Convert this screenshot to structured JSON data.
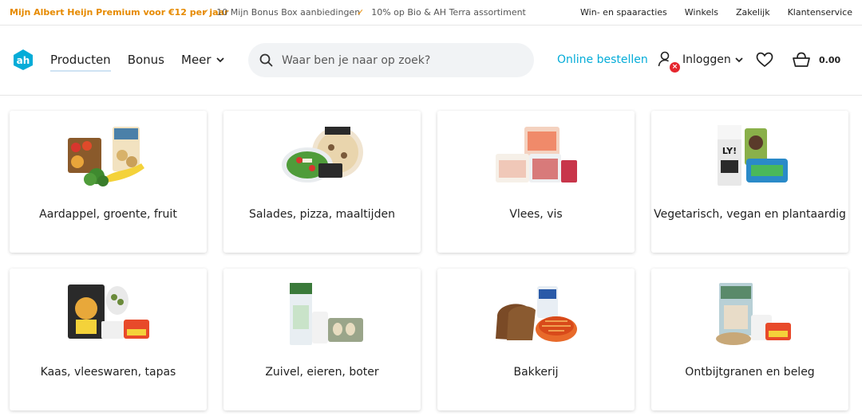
{
  "topbar": {
    "promo": "Mijn Albert Heijn Premium voor €12 per jaar",
    "usps": [
      "10 Mijn Bonus Box aanbiedingen",
      "10% op Bio & AH Terra assortiment"
    ],
    "links": [
      "Win- en spaaracties",
      "Winkels",
      "Zakelijk",
      "Klantenservice"
    ]
  },
  "header": {
    "nav": [
      "Producten",
      "Bonus",
      "Meer"
    ],
    "search_placeholder": "Waar ben je naar op zoek?",
    "online_order": "Online bestellen",
    "login": "Inloggen",
    "basket_total": "0.00"
  },
  "categories": [
    {
      "label": "Aardappel, groente, fruit",
      "image": "produce-icon"
    },
    {
      "label": "Salades, pizza, maaltijden",
      "image": "meals-icon"
    },
    {
      "label": "Vlees, vis",
      "image": "meat-icon"
    },
    {
      "label": "Vegetarisch, vegan en plantaardig",
      "image": "plantbased-icon"
    },
    {
      "label": "Kaas, vleeswaren, tapas",
      "image": "cheese-icon"
    },
    {
      "label": "Zuivel, eieren, boter",
      "image": "dairy-icon"
    },
    {
      "label": "Bakkerij",
      "image": "bakery-icon"
    },
    {
      "label": "Ontbijtgranen en beleg",
      "image": "breakfast-icon"
    }
  ]
}
